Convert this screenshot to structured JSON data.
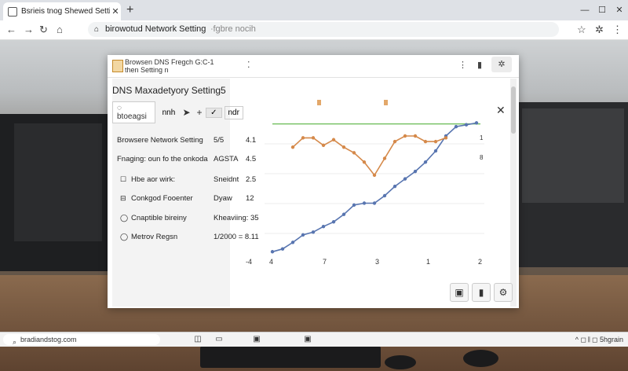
{
  "browser": {
    "tab_title": "Bsrieis tnog Shewed Setting",
    "address": "birowotud Network Setting",
    "address_suffix": "∙fgbre nocih"
  },
  "app": {
    "title_line1": "Browsen DNS Fregch  G:C-1",
    "title_line2": "then Setting n",
    "side_title": "DNS Maxadetyory Setting5",
    "toolbar_tab": "btoeagsi",
    "toolbar_tab2": "nnh",
    "toolbar_tab3": "ndr",
    "rows": [
      {
        "label": "Browsere Network Setting",
        "v1": "5/5",
        "v2": "4.1"
      },
      {
        "label": "Fnaging: oun fo the onkoda",
        "v1": "AGSTA",
        "v2": "4.5"
      },
      {
        "label": "Hbe aor wirk:",
        "v1": "Sneidnt",
        "v2": "2.5"
      },
      {
        "label": "Conkgod Fooenter",
        "v1": "Dyaw",
        "v2": "12"
      },
      {
        "label": "Cnaptible bireiny",
        "v1": "Kheaviing: 35",
        "v2": ""
      },
      {
        "label": "Metrov Regsn",
        "v1": "1/2000 = 8.11",
        "v2": ""
      }
    ],
    "x_ticks": [
      "-4",
      "4",
      "7",
      "3",
      "1",
      "2"
    ],
    "right_labels": [
      "1",
      "8"
    ]
  },
  "chart_data": {
    "type": "line",
    "x": [
      1,
      2,
      3,
      4,
      5,
      6,
      7,
      8,
      9,
      10,
      11,
      12,
      13,
      14,
      15,
      16,
      17,
      18,
      19,
      20,
      21
    ],
    "series": [
      {
        "values": [
          0.2,
          0.35,
          0.7,
          1.1,
          1.25,
          1.55,
          1.8,
          2.2,
          2.7,
          2.8,
          2.8,
          3.2,
          3.7,
          4.1,
          4.5,
          5.0,
          5.6,
          6.4,
          6.9,
          7.0,
          7.1
        ]
      },
      {
        "values": [
          null,
          null,
          5.8,
          6.3,
          6.3,
          5.9,
          6.2,
          5.8,
          5.5,
          5.0,
          4.3,
          5.2,
          6.1,
          6.4,
          6.4,
          6.1,
          6.1,
          6.3,
          null,
          null,
          null
        ]
      }
    ],
    "colors": [
      "#5875b0",
      "#d5894a",
      "#7ac368",
      "#e3a86a"
    ]
  },
  "taskbar": {
    "search": "bradiandstog.com",
    "tray": "^ ◻ 𝄃 ◻ 5hgrain"
  }
}
